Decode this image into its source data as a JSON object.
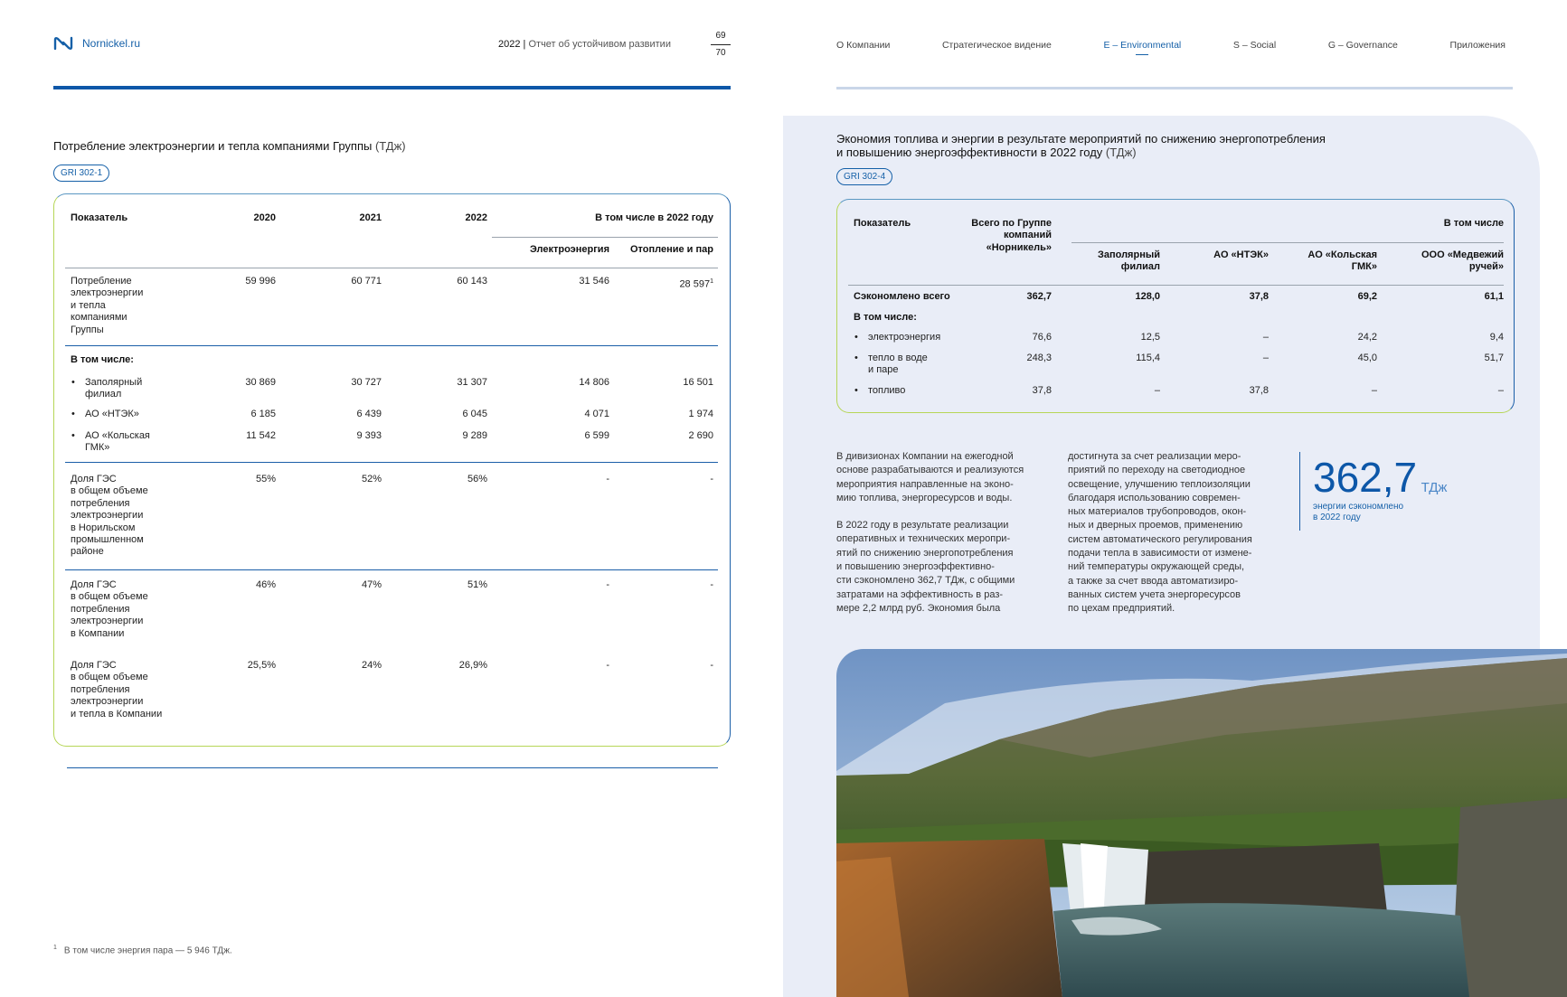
{
  "header": {
    "site": "Nornickel.ru",
    "report_year": "2022",
    "report_sep": "|",
    "report_title": "Отчет об устойчивом развитии",
    "page_current": "69",
    "page_total": "70"
  },
  "nav": {
    "items": [
      "О Компании",
      "Стратегическое видение",
      "E – Environmental",
      "S – Social",
      "G – Governance",
      "Приложения"
    ],
    "active": "E – Environmental"
  },
  "left_table": {
    "title": "Потребление электроэнергии и тепла компаниями Группы",
    "unit": "(ТДж)",
    "gri": "GRI 302-1",
    "headers": {
      "indicator": "Показатель",
      "y2020": "2020",
      "y2021": "2021",
      "y2022": "2022",
      "incl": "В том числе в 2022 году",
      "electricity": "Электроэнергия",
      "heat": "Отопление и пар"
    },
    "rows": {
      "total": {
        "label": "Потребление\nэлектроэнергии\nи тепла\nкомпаниями\nГруппы",
        "v2020": "59 996",
        "v2021": "60 771",
        "v2022": "60 143",
        "el": "31 546",
        "heat": "28 597",
        "heat_note": "1"
      },
      "incl_label": "В том числе:",
      "zf": {
        "label": "Заполярный\nфилиал",
        "v2020": "30 869",
        "v2021": "30 727",
        "v2022": "31 307",
        "el": "14 806",
        "heat": "16 501"
      },
      "ntek": {
        "label": "АО «НТЭК»",
        "v2020": "6 185",
        "v2021": "6 439",
        "v2022": "6 045",
        "el": "4 071",
        "heat": "1 974"
      },
      "kola": {
        "label": "АО «Кольская\nГМК»",
        "v2020": "11 542",
        "v2021": "9 393",
        "v2022": "9 289",
        "el": "6 599",
        "heat": "2 690"
      },
      "hpp1": {
        "label": "Доля ГЭС\nв общем объеме\nпотребления\nэлектроэнергии\nв Норильском\nпромышленном\nрайоне",
        "v2020": "55%",
        "v2021": "52%",
        "v2022": "56%",
        "el": "-",
        "heat": "-"
      },
      "hpp2": {
        "label": "Доля ГЭС\nв общем объеме\nпотребления\nэлектроэнергии\nв Компании",
        "v2020": "46%",
        "v2021": "47%",
        "v2022": "51%",
        "el": "-",
        "heat": "-"
      },
      "hpp3": {
        "label": "Доля ГЭС\nв общем объеме\nпотребления\nэлектроэнергии\nи тепла в Компании",
        "v2020": "25,5%",
        "v2021": "24%",
        "v2022": "26,9%",
        "el": "-",
        "heat": "-"
      }
    }
  },
  "right_table": {
    "title_line1": "Экономия топлива и энергии в результате мероприятий по снижению энергопотребления",
    "title_line2": "и повышению энергоэффективности в 2022 году",
    "unit": "(ТДж)",
    "gri": "GRI 302-4",
    "headers": {
      "indicator": "Показатель",
      "total": "Всего по Группе\nкомпаний\n«Норникель»",
      "incl": "В том числе",
      "zf": "Заполярный\nфилиал",
      "ntek": "АО «НТЭК»",
      "kola": "АО «Кольская\nГМК»",
      "medv": "ООО «Медвежий\nручей»"
    },
    "rows": {
      "saved": {
        "label": "Сэкономлено всего",
        "total": "362,7",
        "zf": "128,0",
        "ntek": "37,8",
        "kola": "69,2",
        "medv": "61,1"
      },
      "incl_label": "В том числе:",
      "el": {
        "label": "электроэнергия",
        "total": "76,6",
        "zf": "12,5",
        "ntek": "–",
        "kola": "24,2",
        "medv": "9,4"
      },
      "heat": {
        "label": "тепло в воде\nи паре",
        "total": "248,3",
        "zf": "115,4",
        "ntek": "–",
        "kola": "45,0",
        "medv": "51,7"
      },
      "fuel": {
        "label": "топливо",
        "total": "37,8",
        "zf": "–",
        "ntek": "37,8",
        "kola": "–",
        "medv": "–"
      }
    }
  },
  "text": {
    "col1": "В дивизионах Компании на ежегодной\nоснове разрабатываются и реализуются\nмероприятия направленные на эконо-\nмию топлива, энергоресурсов и воды.",
    "col1b": "В 2022 году в результате реализации\nоперативных и технических меропри-\nятий по снижению энергопотребления\nи повышению энергоэффективно-\nсти сэкономлено 362,7 ТДж, с общими\nзатратами на эффективность в раз-\nмере 2,2 млрд руб. Экономия была",
    "col2": "достигнута за счет реализации меро-\nприятий по переходу на светодиодное\nосвещение, улучшению теплоизоляции\nблагодаря использованию современ-\nных материалов трубопроводов, окон-\nных и дверных проемов, применению\nсистем автоматического регулирования\nподачи тепла в зависимости от измене-\nний температуры окружающей среды,\nа также за счет ввода автоматизиро-\nванных систем учета энергоресурсов\nпо цехам предприятий."
  },
  "highlight": {
    "value": "362,7",
    "unit": "ТДж",
    "caption": "энергии сэкономлено\nв 2022 году"
  },
  "footnote": {
    "mark": "1",
    "text": "В том числе энергия пара — 5 946 ТДж."
  },
  "colors": {
    "accent": "#0d57a8",
    "panel": "#e9edf7",
    "border_green": "#b6d657"
  }
}
